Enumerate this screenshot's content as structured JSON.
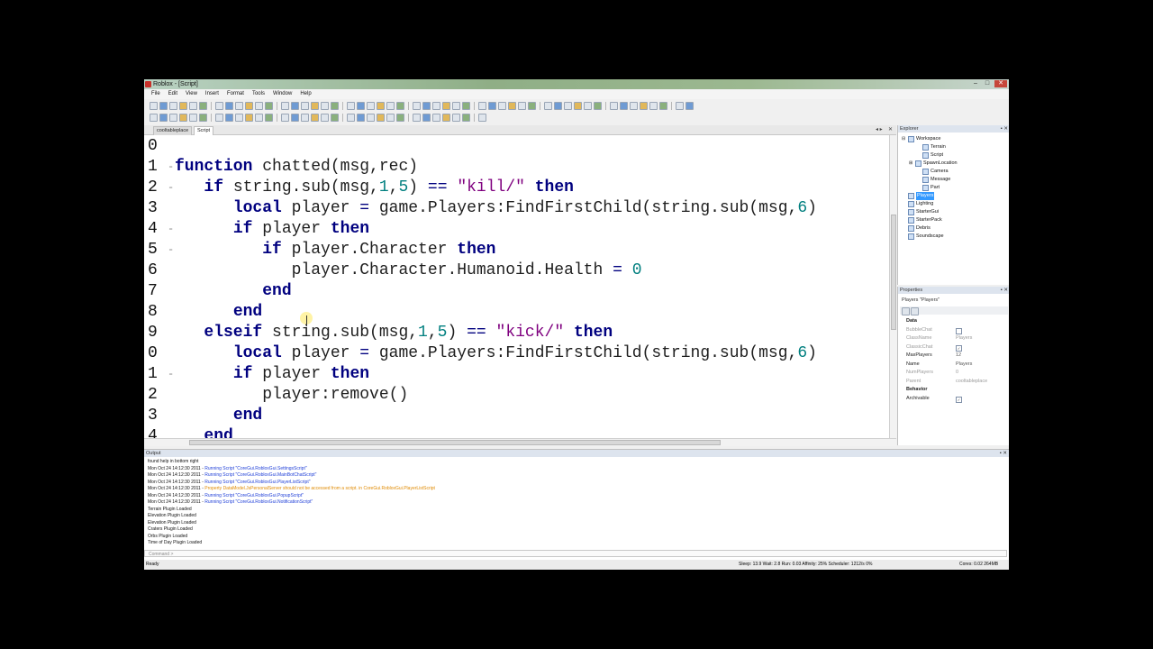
{
  "window": {
    "title": "Roblox - [Script]",
    "controls": [
      "–",
      "□",
      "✕"
    ]
  },
  "menu": [
    "File",
    "Edit",
    "View",
    "Insert",
    "Format",
    "Tools",
    "Window",
    "Help"
  ],
  "tabs": [
    {
      "label": "cooltableplace"
    },
    {
      "label": "Script"
    }
  ],
  "tab_controls": [
    "◂ ▸",
    "✕"
  ],
  "editor": {
    "lines": [
      {
        "num": "0",
        "fold": "",
        "tokens": []
      },
      {
        "num": "1",
        "fold": "-",
        "tokens": [
          [
            "kw",
            "function"
          ],
          [
            "t",
            " chatted(msg,rec)"
          ]
        ]
      },
      {
        "num": "2",
        "fold": "-",
        "tokens": [
          [
            "t",
            "   "
          ],
          [
            "kw",
            "if"
          ],
          [
            "t",
            " string.sub(msg,"
          ],
          [
            "num",
            "1"
          ],
          [
            "t",
            ","
          ],
          [
            "num",
            "5"
          ],
          [
            "t",
            ") "
          ],
          [
            "op",
            "=="
          ],
          [
            "t",
            " "
          ],
          [
            "str",
            "\"kill/\""
          ],
          [
            "t",
            " "
          ],
          [
            "kw",
            "then"
          ]
        ]
      },
      {
        "num": "3",
        "fold": "",
        "tokens": [
          [
            "t",
            "      "
          ],
          [
            "kw",
            "local"
          ],
          [
            "t",
            " player "
          ],
          [
            "op",
            "="
          ],
          [
            "t",
            " game.Players:FindFirstChild(string.sub(msg,"
          ],
          [
            "num",
            "6"
          ],
          [
            "t",
            ")"
          ]
        ]
      },
      {
        "num": "4",
        "fold": "-",
        "tokens": [
          [
            "t",
            "      "
          ],
          [
            "kw",
            "if"
          ],
          [
            "t",
            " player "
          ],
          [
            "kw",
            "then"
          ]
        ]
      },
      {
        "num": "5",
        "fold": "-",
        "tokens": [
          [
            "t",
            "         "
          ],
          [
            "kw",
            "if"
          ],
          [
            "t",
            " player.Character "
          ],
          [
            "kw",
            "then"
          ]
        ]
      },
      {
        "num": "6",
        "fold": "",
        "tokens": [
          [
            "t",
            "            player.Character.Humanoid.Health "
          ],
          [
            "op",
            "="
          ],
          [
            "t",
            " "
          ],
          [
            "num",
            "0"
          ]
        ]
      },
      {
        "num": "7",
        "fold": "",
        "tokens": [
          [
            "t",
            "         "
          ],
          [
            "kw",
            "end"
          ]
        ]
      },
      {
        "num": "8",
        "fold": "",
        "tokens": [
          [
            "t",
            "      "
          ],
          [
            "kw",
            "end"
          ]
        ]
      },
      {
        "num": "9",
        "fold": "",
        "tokens": [
          [
            "t",
            "   "
          ],
          [
            "kw",
            "elseif"
          ],
          [
            "t",
            " string.sub(msg,"
          ],
          [
            "num",
            "1"
          ],
          [
            "t",
            ","
          ],
          [
            "num",
            "5"
          ],
          [
            "t",
            ") "
          ],
          [
            "op",
            "=="
          ],
          [
            "t",
            " "
          ],
          [
            "str",
            "\"kick/\""
          ],
          [
            "t",
            " "
          ],
          [
            "kw",
            "then"
          ]
        ]
      },
      {
        "num": "0",
        "fold": "",
        "tokens": [
          [
            "t",
            "      "
          ],
          [
            "kw",
            "local"
          ],
          [
            "t",
            " player "
          ],
          [
            "op",
            "="
          ],
          [
            "t",
            " game.Players:FindFirstChild(string.sub(msg,"
          ],
          [
            "num",
            "6"
          ],
          [
            "t",
            ")"
          ]
        ]
      },
      {
        "num": "1",
        "fold": "-",
        "tokens": [
          [
            "t",
            "      "
          ],
          [
            "kw",
            "if"
          ],
          [
            "t",
            " player "
          ],
          [
            "kw",
            "then"
          ]
        ]
      },
      {
        "num": "2",
        "fold": "",
        "tokens": [
          [
            "t",
            "         player:remove()"
          ]
        ]
      },
      {
        "num": "3",
        "fold": "",
        "tokens": [
          [
            "t",
            "      "
          ],
          [
            "kw",
            "end"
          ]
        ]
      },
      {
        "num": "4",
        "fold": "",
        "tokens": [
          [
            "t",
            "   "
          ],
          [
            "kw",
            "end"
          ]
        ]
      }
    ]
  },
  "explorer": {
    "header": "Explorer",
    "items": [
      {
        "label": "Workspace",
        "depth": 0,
        "expander": "⊟",
        "selected": false
      },
      {
        "label": "Terrain",
        "depth": 2,
        "expander": "",
        "selected": false
      },
      {
        "label": "Script",
        "depth": 2,
        "expander": "",
        "selected": false
      },
      {
        "label": "SpawnLocation",
        "depth": 1,
        "expander": "⊞",
        "selected": false
      },
      {
        "label": "Camera",
        "depth": 2,
        "expander": "",
        "selected": false
      },
      {
        "label": "Message",
        "depth": 2,
        "expander": "",
        "selected": false
      },
      {
        "label": "Part",
        "depth": 2,
        "expander": "",
        "selected": false
      },
      {
        "label": "Players",
        "depth": 0,
        "expander": "",
        "selected": true
      },
      {
        "label": "Lighting",
        "depth": 0,
        "expander": "",
        "selected": false
      },
      {
        "label": "StarterGui",
        "depth": 0,
        "expander": "",
        "selected": false
      },
      {
        "label": "StarterPack",
        "depth": 0,
        "expander": "",
        "selected": false
      },
      {
        "label": "Debris",
        "depth": 0,
        "expander": "",
        "selected": false
      },
      {
        "label": "Soundscape",
        "depth": 0,
        "expander": "",
        "selected": false
      }
    ]
  },
  "properties": {
    "header": "Properties",
    "object_label": "Players \"Players\"",
    "categories": [
      {
        "name": "Data",
        "rows": [
          {
            "key": "BubbleChat",
            "value": "",
            "checkbox": true,
            "checked": false,
            "dim": true
          },
          {
            "key": "ClassName",
            "value": "Players",
            "checkbox": false,
            "dim": true
          },
          {
            "key": "ClassicChat",
            "value": "",
            "checkbox": true,
            "checked": true,
            "dim": true
          },
          {
            "key": "MaxPlayers",
            "value": "12",
            "checkbox": false,
            "dim": false
          },
          {
            "key": "Name",
            "value": "Players",
            "checkbox": false,
            "dim": false
          },
          {
            "key": "NumPlayers",
            "value": "0",
            "checkbox": false,
            "dim": true
          },
          {
            "key": "Parent",
            "value": "cooltableplace",
            "checkbox": false,
            "dim": true
          }
        ]
      },
      {
        "name": "Behavior",
        "rows": [
          {
            "key": "Archivable",
            "value": "",
            "checkbox": true,
            "checked": true,
            "dim": false
          }
        ]
      }
    ]
  },
  "output": {
    "header": "Output",
    "lines": [
      {
        "prefix": "found help in bottom right",
        "text": "",
        "style": ""
      },
      {
        "prefix": "Mon Oct 24 14:12:30 2011 - ",
        "text": "Running Script \"CoreGui.RobloxGui.SettingsScript\"",
        "style": "blue"
      },
      {
        "prefix": "Mon Oct 24 14:12:30 2011 - ",
        "text": "Running Script \"CoreGui.RobloxGui.MainBotChatScript\"",
        "style": "blue"
      },
      {
        "prefix": "Mon Oct 24 14:12:30 2011 - ",
        "text": "Running Script \"CoreGui.RobloxGui.PlayerListScript\"",
        "style": "blue"
      },
      {
        "prefix": "Mon Oct 24 14:12:30 2011 - ",
        "text": "Property DataModel.JsPersonalServer should not be accessed from a script. in CoreGui.RobloxGui.PlayerListScript",
        "style": "orange"
      },
      {
        "prefix": "Mon Oct 24 14:12:30 2011 - ",
        "text": "Running Script \"CoreGui.RobloxGui.PopupScript\"",
        "style": "blue"
      },
      {
        "prefix": "Mon Oct 24 14:12:30 2011 - ",
        "text": "Running Script \"CoreGui.RobloxGui.NotificationScript\"",
        "style": "blue"
      },
      {
        "prefix": "Terrain Plugin Loaded",
        "text": "",
        "style": ""
      },
      {
        "prefix": "Elevation Plugin Loaded",
        "text": "",
        "style": ""
      },
      {
        "prefix": "Elevation Plugin Loaded",
        "text": "",
        "style": ""
      },
      {
        "prefix": "Craters Plugin Loaded",
        "text": "",
        "style": ""
      },
      {
        "prefix": "Orbs Plugin Loaded",
        "text": "",
        "style": ""
      },
      {
        "prefix": "Time of Day Plugin Loaded",
        "text": "",
        "style": ""
      }
    ],
    "command_placeholder": "Command >"
  },
  "status": {
    "left": "Ready",
    "mid": "Sleep: 13.9 Wait: 2.8 Run: 0.03 Affinity: 25% Scheduler: 1212/s 0%",
    "right": "Cores: 0.02    264MB"
  }
}
